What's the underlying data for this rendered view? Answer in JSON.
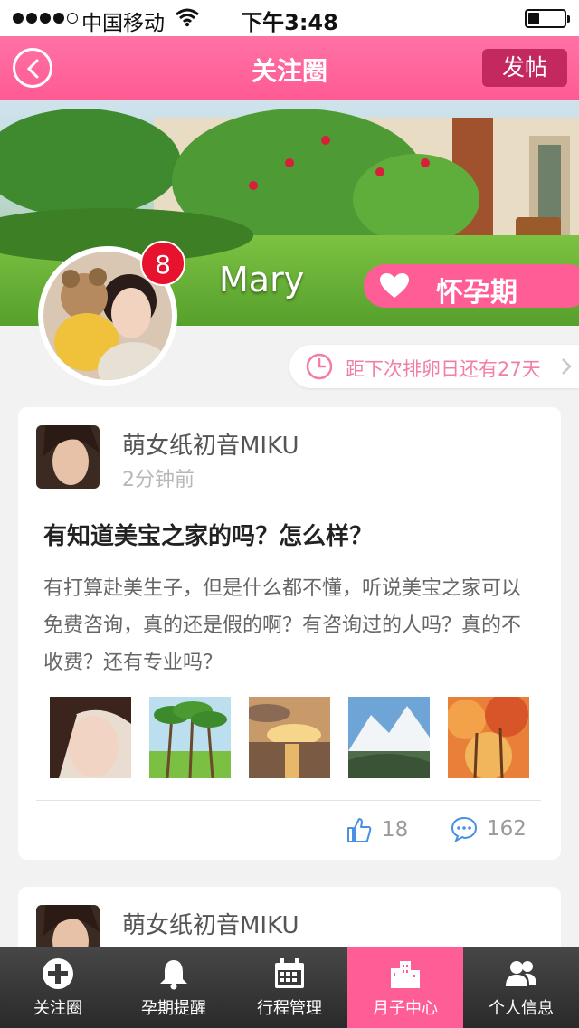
{
  "status_bar": {
    "carrier": "中国移动",
    "time": "下午3:48",
    "signal_strength": 4
  },
  "nav": {
    "title": "关注圈",
    "post_label": "发帖"
  },
  "profile": {
    "username": "Mary",
    "stage_label": "怀孕期",
    "notification_count": "8",
    "ovulation_text": "距下次排卵日还有27天"
  },
  "posts": [
    {
      "author": "萌女纸初音MIKU",
      "time": "2分钟前",
      "title": "有知道美宝之家的吗？怎么样？",
      "body": "有打算赴美生子，但是什么都不懂，听说美宝之家可以免费咨询，真的还是假的啊？有咨询过的人吗？真的不收费？还有专业吗？",
      "likes": "18",
      "comments": "162"
    },
    {
      "author": "萌女纸初音MIKU"
    }
  ],
  "tabs": [
    {
      "label": "关注圈",
      "icon": "plus-circle-icon"
    },
    {
      "label": "孕期提醒",
      "icon": "bell-icon"
    },
    {
      "label": "行程管理",
      "icon": "calendar-icon"
    },
    {
      "label": "月子中心",
      "icon": "buildings-icon"
    },
    {
      "label": "个人信息",
      "icon": "people-icon"
    }
  ],
  "colors": {
    "accent": "#ff5d95",
    "nav_bar": "#ff6a9f",
    "post_button": "#c3285e",
    "badge": "#e7122d",
    "action_icon": "#4a90e2"
  }
}
